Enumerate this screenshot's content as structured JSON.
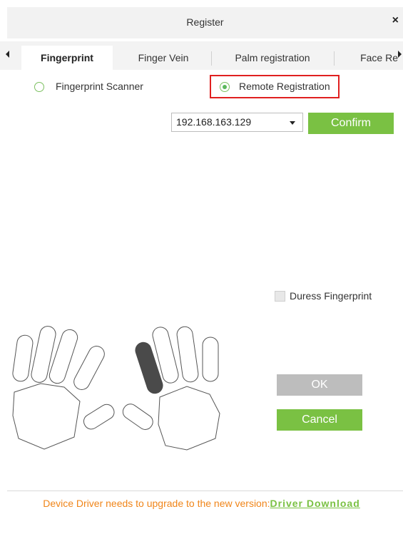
{
  "dialog": {
    "title": "Register",
    "close_symbol": "×"
  },
  "tabs": [
    {
      "label": "Fingerprint",
      "active": true
    },
    {
      "label": "Finger Vein",
      "active": false
    },
    {
      "label": "Palm registration",
      "active": false
    },
    {
      "label": "Face Re",
      "active": false
    }
  ],
  "mode": {
    "options": [
      {
        "label": "Fingerprint Scanner",
        "selected": false
      },
      {
        "label": "Remote Registration",
        "selected": true
      }
    ]
  },
  "device": {
    "selected_ip": "192.168.163.129",
    "confirm_label": "Confirm"
  },
  "duress": {
    "label": "Duress Fingerprint",
    "checked": false
  },
  "buttons": {
    "ok_label": "OK",
    "cancel_label": "Cancel"
  },
  "footer": {
    "message": "Device Driver needs to upgrade to the new version:",
    "link_label": "Driver Download"
  },
  "colors": {
    "accent_green": "#7ac143",
    "warning_orange": "#f08519",
    "highlight_red": "#e02020",
    "disabled_gray": "#bdbdbd",
    "finger_selected": "#4a4a4a"
  },
  "hands": {
    "selected_finger": "right-index"
  }
}
